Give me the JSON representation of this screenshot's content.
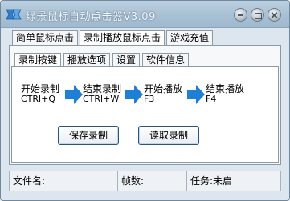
{
  "window": {
    "title": "绿景鼠标自动点击器V3.09"
  },
  "main_tabs": [
    {
      "label": "简单鼠标点击",
      "active": false
    },
    {
      "label": "录制播放鼠标点击",
      "active": true
    },
    {
      "label": "游戏充值",
      "active": false
    }
  ],
  "sub_tabs": [
    {
      "label": "录制按键",
      "active": true
    },
    {
      "label": "播放选项",
      "active": false
    },
    {
      "label": "设置",
      "active": false
    },
    {
      "label": "软件信息",
      "active": false
    }
  ],
  "steps": [
    {
      "label": "开始录制",
      "key": "CTRl+Q"
    },
    {
      "label": "结束录制",
      "key": "CTRl+W"
    },
    {
      "label": "开始播放",
      "key": "F3"
    },
    {
      "label": "结束播放",
      "key": "F4"
    }
  ],
  "buttons": {
    "save_label": "保存录制",
    "load_label": "读取录制"
  },
  "status": {
    "filename_label": "文件名:",
    "frames_label": "帧数:",
    "task_label": "任务:未启"
  },
  "colors": {
    "arrow": "#1e7fd6",
    "title_bar": "#a8c0d4"
  }
}
